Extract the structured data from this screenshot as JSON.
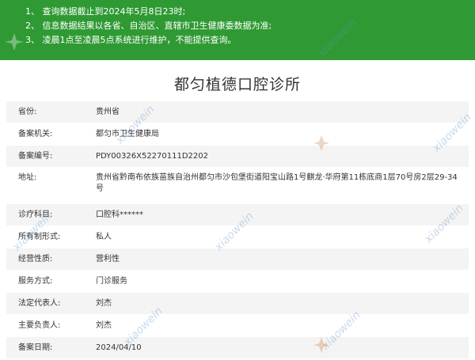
{
  "notice": {
    "lines": [
      "1、  查询数据截止到2024年5月8日23时;",
      "2、  信息数据结果以各省、自治区、直辖市卫生健康委数据为准;",
      "3、  凌晨1点至凌晨5点系统进行维护，不能提供查询。"
    ]
  },
  "page_title": "都匀植德口腔诊所",
  "records": [
    {
      "label": "省份:",
      "value": "贵州省"
    },
    {
      "label": "备案机关:",
      "value": "都匀市卫生健康局"
    },
    {
      "label": "备案编号:",
      "value": "PDY00326X52270111D2202"
    },
    {
      "label": "地址:",
      "value": "贵州省黔南布依族苗族自治州都匀市沙包堡街道阳宝山路1号麒龙·华府第11栋底商1层70号房2层29-34号"
    },
    {
      "label": "诊疗科目:",
      "value": "口腔科******"
    },
    {
      "label": "所有制形式:",
      "value": "私人"
    },
    {
      "label": "经营性质:",
      "value": "营利性"
    },
    {
      "label": "服务方式:",
      "value": "门诊服务"
    },
    {
      "label": "法定代表人:",
      "value": "刘杰"
    },
    {
      "label": "主要负责人:",
      "value": "刘杰"
    },
    {
      "label": "备案日期:",
      "value": "2024/04/10"
    }
  ],
  "watermark": {
    "text": "xiaowein"
  },
  "colors": {
    "notice_bg": "#2f9a33",
    "row_alt": "#f4f4f4"
  }
}
